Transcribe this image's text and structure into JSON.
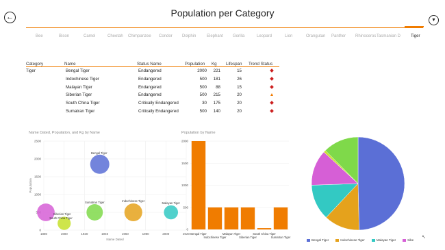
{
  "header": {
    "title": "Population per Category",
    "back_icon": "back-arrow-icon",
    "filter_icon": "filter-icon"
  },
  "tabs": [
    {
      "label": "Bee",
      "selected": false
    },
    {
      "label": "Bison",
      "selected": false
    },
    {
      "label": "Camel",
      "selected": false
    },
    {
      "label": "Cheetah",
      "selected": false
    },
    {
      "label": "Chimpanzee",
      "selected": false
    },
    {
      "label": "Condor",
      "selected": false
    },
    {
      "label": "Dolphin",
      "selected": false
    },
    {
      "label": "Elephant",
      "selected": false
    },
    {
      "label": "Gorilla",
      "selected": false
    },
    {
      "label": "Leopard",
      "selected": false
    },
    {
      "label": "Lion",
      "selected": false
    },
    {
      "label": "Orangutan",
      "selected": false
    },
    {
      "label": "Panther",
      "selected": false
    },
    {
      "label": "Rhinoceros",
      "selected": false
    },
    {
      "label": "Tasmanian D",
      "selected": false
    },
    {
      "label": "Tiger",
      "selected": true
    }
  ],
  "table": {
    "headers": [
      "Category",
      "Name",
      "Status Name",
      "Population",
      "Kg",
      "Lifespan",
      "Trend Status"
    ],
    "rows": [
      {
        "category": "Tiger",
        "name": "Bengal Tiger",
        "status": "Endangered",
        "population": "2000",
        "kg": "221",
        "lifespan": "15",
        "trend": "diamond"
      },
      {
        "category": "",
        "name": "Indochinese Tiger",
        "status": "Endangered",
        "population": "500",
        "kg": "181",
        "lifespan": "26",
        "trend": "diamond"
      },
      {
        "category": "",
        "name": "Malayan Tiger",
        "status": "Endangered",
        "population": "500",
        "kg": "88",
        "lifespan": "15",
        "trend": "diamond"
      },
      {
        "category": "",
        "name": "Siberian Tiger",
        "status": "Endangered",
        "population": "500",
        "kg": "215",
        "lifespan": "20",
        "trend": "triangle"
      },
      {
        "category": "",
        "name": "South China Tiger",
        "status": "Critically Endangered",
        "population": "30",
        "kg": "175",
        "lifespan": "20",
        "trend": "diamond"
      },
      {
        "category": "",
        "name": "Sumatran Tiger",
        "status": "Critically Endangered",
        "population": "500",
        "kg": "140",
        "lifespan": "20",
        "trend": "diamond"
      }
    ],
    "trend_colors": {
      "diamond": "#cc1f1f",
      "triangle": "#f07c00"
    }
  },
  "chart_data": [
    {
      "type": "scatter",
      "title": "Name Dated, Population, and Kg by Name",
      "xlabel": "Name Dated",
      "ylabel": "Population",
      "xlim": [
        1880,
        2020
      ],
      "ylim": [
        0,
        2500
      ],
      "x_ticks": [
        "1880",
        "1900",
        "1920",
        "1940",
        "1960",
        "1980",
        "2000",
        "2020"
      ],
      "y_ticks": [
        "0",
        "500",
        "1000",
        "1500",
        "2000",
        "2500"
      ],
      "points": [
        {
          "name": "Bengal Tiger",
          "x": 1935,
          "y": 1850,
          "size": 221,
          "color": "#5b6fd6"
        },
        {
          "name": "Indochinese Tiger",
          "x": 1968,
          "y": 500,
          "size": 181,
          "color": "#e5a21c"
        },
        {
          "name": "Malayan Tiger",
          "x": 2005,
          "y": 500,
          "size": 88,
          "color": "#33c9c3"
        },
        {
          "name": "Siberian Tiger",
          "x": 1900,
          "y": 190,
          "size": 70,
          "color": "#c5e02c"
        },
        {
          "name": "South China Tiger",
          "x": 1882,
          "y": 500,
          "size": 175,
          "color": "#d65fd6"
        },
        {
          "name": "Sumatran Tiger",
          "x": 1930,
          "y": 500,
          "size": 140,
          "color": "#7fd94a"
        }
      ],
      "labels": [
        {
          "text": "Bengal Tiger",
          "point": "Bengal Tiger"
        },
        {
          "text": "Indochinese Tiger",
          "point": "Indochinese Tiger"
        },
        {
          "text": "Malayan Tiger",
          "point": "Malayan Tiger"
        },
        {
          "text": "Sumatran Tiger",
          "point": "Sumatran Tiger"
        },
        {
          "text": "Siberian Tiger",
          "point": "Siberian Tiger"
        },
        {
          "text": "South China Tiger",
          "point": "South China Tiger"
        }
      ]
    },
    {
      "type": "bar",
      "title": "Population by Name",
      "categories": [
        "Bengal Tiger",
        "Indochinese Tiger",
        "Malayan Tiger",
        "Siberian Tiger",
        "South China Tiger",
        "Sumatran Tiger"
      ],
      "values": [
        2000,
        500,
        500,
        500,
        30,
        500
      ],
      "ylim": [
        0,
        2000
      ],
      "y_ticks": [
        "0",
        "500",
        "1000",
        "1500",
        "2000"
      ],
      "color": "#f07c00"
    },
    {
      "type": "pie",
      "series": [
        {
          "name": "Bengal Tiger",
          "value": 2000,
          "color": "#5b6fd6"
        },
        {
          "name": "Indochinese Tiger",
          "value": 500,
          "color": "#e5a21c"
        },
        {
          "name": "Malayan Tiger",
          "value": 500,
          "color": "#33c9c3"
        },
        {
          "name": "Sibe",
          "value": 500,
          "color": "#d65fd6"
        },
        {
          "name": "",
          "value": 30,
          "color": "#c5e02c"
        },
        {
          "name": "",
          "value": 500,
          "color": "#7fd94a"
        }
      ],
      "legend": [
        "Bengal Tiger",
        "Indochinese Tiger",
        "Malayan Tiger",
        "Sibe"
      ]
    }
  ]
}
